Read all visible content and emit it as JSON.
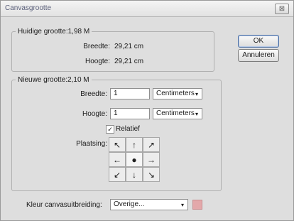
{
  "dialog": {
    "title": "Canvasgrootte",
    "close_label": "⊠",
    "ok_label": "OK",
    "cancel_label": "Annuleren"
  },
  "current": {
    "legend": "Huidige grootte:1,98 M",
    "width_label": "Breedte:",
    "width_value": "29,21 cm",
    "height_label": "Hoogte:",
    "height_value": "29,21 cm"
  },
  "new": {
    "legend": "Nieuwe grootte:2,10 M",
    "width_label": "Breedte:",
    "width_value": "1",
    "width_unit": "Centimeters",
    "height_label": "Hoogte:",
    "height_value": "1",
    "height_unit": "Centimeters",
    "relative_label": "Relatief",
    "relative_checked": true,
    "relative_mark": "✓",
    "anchor_label": "Plaatsing:",
    "anchor_cells": [
      {
        "glyph": "↖",
        "icon": "arrow-up-left-icon"
      },
      {
        "glyph": "↑",
        "icon": "arrow-up-icon"
      },
      {
        "glyph": "↗",
        "icon": "arrow-up-right-icon"
      },
      {
        "glyph": "←",
        "icon": "arrow-left-icon"
      },
      {
        "glyph": "●",
        "icon": "anchor-center-icon"
      },
      {
        "glyph": "→",
        "icon": "arrow-right-icon"
      },
      {
        "glyph": "↙",
        "icon": "arrow-down-left-icon"
      },
      {
        "glyph": "↓",
        "icon": "arrow-down-icon"
      },
      {
        "glyph": "↘",
        "icon": "arrow-down-right-icon"
      }
    ]
  },
  "extension": {
    "label": "Kleur canvasuitbreiding:",
    "value": "Overige...",
    "swatch_color": "#e3a8aa"
  },
  "icons": {
    "dropdown_arrow": "▾"
  }
}
